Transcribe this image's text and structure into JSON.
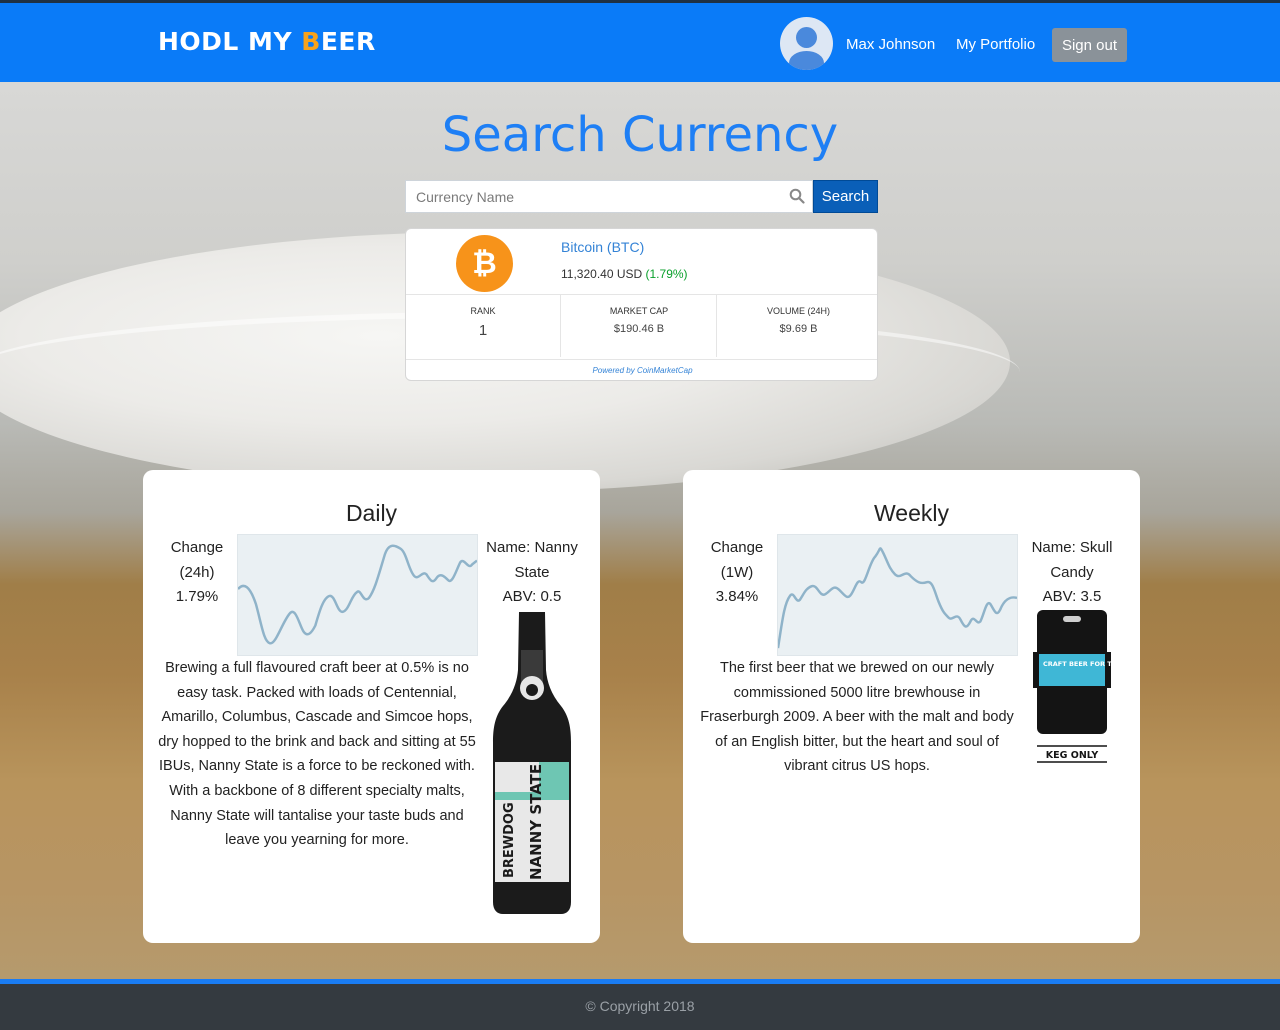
{
  "navbar": {
    "brand_pre": "HODL MY ",
    "brand_b": "B",
    "brand_post": "EER",
    "user_name": "Max Johnson",
    "portfolio_label": "My Portfolio",
    "signout_label": "Sign out"
  },
  "search": {
    "title": "Search Currency",
    "placeholder": "Currency Name",
    "button_label": "Search"
  },
  "coin": {
    "symbol_glyph": "₿",
    "name": "Bitcoin (BTC)",
    "price": "11,320.40 USD",
    "change": "(1.79%)",
    "stats": [
      {
        "label": "RANK",
        "value": "1"
      },
      {
        "label": "MARKET CAP",
        "value": "$190.46 B"
      },
      {
        "label": "VOLUME (24H)",
        "value": "$9.69 B"
      }
    ],
    "powered_by": "Powered by CoinMarketCap"
  },
  "daily": {
    "title": "Daily",
    "change_label_1": "Change",
    "change_label_2": "(24h)",
    "change_value": "1.79%",
    "beer_name_1": "Name: Nanny",
    "beer_name_2": "State",
    "beer_abv": "ABV: 0.5",
    "description": "Brewing a full flavoured craft beer at 0.5% is no easy task. Packed with loads of Centennial, Amarillo, Columbus, Cascade and Simcoe hops, dry hopped to the brink and back and sitting at 55 IBUs, Nanny State is a force to be reckoned with. With a backbone of 8 different specialty malts, Nanny State will tantalise your taste buds and leave you yearning for more.",
    "bottle_label_1": "BREWDOG",
    "bottle_label_2": "NANNY STATE"
  },
  "weekly": {
    "title": "Weekly",
    "change_label_1": "Change",
    "change_label_2": "(1W)",
    "change_value": "3.84%",
    "beer_name_1": "Name: Skull",
    "beer_name_2": "Candy",
    "beer_abv": "ABV: 3.5",
    "description": "The first beer that we brewed on our newly commissioned 5000 litre brewhouse in Fraserburgh 2009. A beer with the malt and body of an English bitter, but the heart and soul of vibrant citrus US hops.",
    "keg_label": "CRAFT BEER FOR THE PEOPLE",
    "keg_only": "KEG ONLY"
  },
  "footer": {
    "copyright": "© Copyright 2018"
  },
  "colors": {
    "navbar": "#0a7bf8",
    "accent_title": "#1e7ff5",
    "bitcoin": "#f7931a",
    "positive": "#09a02b",
    "spark_line": "#8fb3c9"
  }
}
